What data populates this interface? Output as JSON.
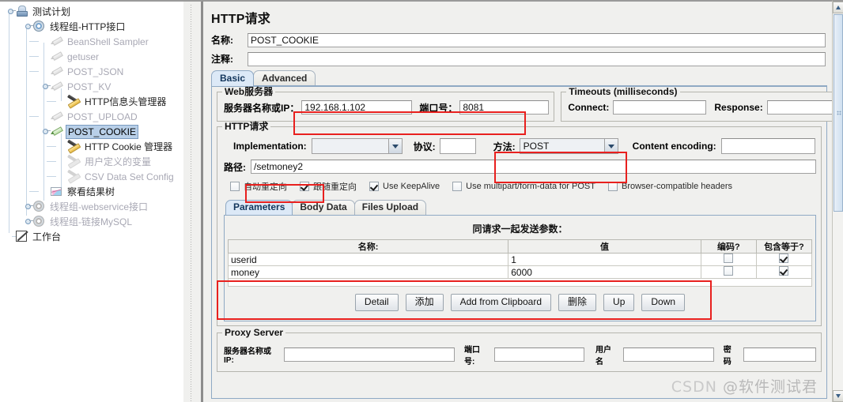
{
  "tree": {
    "nodes": [
      {
        "label": "测试计划",
        "icon": "test-plan-icon",
        "depth": 0,
        "state": "normal"
      },
      {
        "label": "线程组-HTTP接口",
        "icon": "thread-group-icon",
        "depth": 1,
        "state": "normal"
      },
      {
        "label": "BeanShell Sampler",
        "icon": "sampler-icon",
        "depth": 2,
        "state": "disabled"
      },
      {
        "label": "getuser",
        "icon": "sampler-icon",
        "depth": 2,
        "state": "disabled"
      },
      {
        "label": "POST_JSON",
        "icon": "sampler-icon",
        "depth": 2,
        "state": "disabled"
      },
      {
        "label": "POST_KV",
        "icon": "sampler-icon",
        "depth": 2,
        "state": "disabled"
      },
      {
        "label": "HTTP信息头管理器",
        "icon": "header-manager-icon",
        "depth": 3,
        "state": "normal"
      },
      {
        "label": "POST_UPLOAD",
        "icon": "sampler-icon",
        "depth": 2,
        "state": "disabled"
      },
      {
        "label": "POST_COOKIE",
        "icon": "http-sampler-icon",
        "depth": 2,
        "state": "selected"
      },
      {
        "label": "HTTP Cookie 管理器",
        "icon": "cookie-manager-icon",
        "depth": 3,
        "state": "normal"
      },
      {
        "label": "用户定义的变量",
        "icon": "user-variables-icon",
        "depth": 3,
        "state": "disabled"
      },
      {
        "label": "CSV Data Set Config",
        "icon": "csv-config-icon",
        "depth": 3,
        "state": "disabled"
      },
      {
        "label": "察看结果树",
        "icon": "view-results-tree-icon",
        "depth": 2,
        "state": "normal"
      },
      {
        "label": "线程组-webservice接口",
        "icon": "thread-group-icon",
        "depth": 1,
        "state": "disabled"
      },
      {
        "label": "线程组-链接MySQL",
        "icon": "thread-group-icon",
        "depth": 1,
        "state": "disabled"
      },
      {
        "label": "工作台",
        "icon": "workbench-icon",
        "depth": 0,
        "state": "normal"
      }
    ]
  },
  "main": {
    "title": "HTTP请求",
    "name_label": "名称:",
    "name_value": "POST_COOKIE",
    "comment_label": "注释:",
    "comment_value": "",
    "tabs": [
      {
        "label": "Basic",
        "active": true
      },
      {
        "label": "Advanced",
        "active": false
      }
    ],
    "web_server": {
      "legend": "Web服务器",
      "server_label": "服务器名称或IP：",
      "server_value": "192.168.1.102",
      "port_label": "端口号：",
      "port_value": "8081"
    },
    "timeouts": {
      "legend": "Timeouts (milliseconds)",
      "connect_label": "Connect:",
      "connect_value": "",
      "response_label": "Response:",
      "response_value": ""
    },
    "http_request": {
      "legend": "HTTP请求",
      "implementation_label": "Implementation:",
      "implementation_value": "",
      "protocol_label": "协议:",
      "protocol_value": "",
      "method_label": "方法:",
      "method_value": "POST",
      "content_encoding_label": "Content encoding:",
      "content_encoding_value": "",
      "path_label": "路径:",
      "path_value": "/setmoney2"
    },
    "options": [
      {
        "label": "自动重定向",
        "checked": false
      },
      {
        "label": "跟随重定向",
        "checked": true
      },
      {
        "label": "Use KeepAlive",
        "checked": true
      },
      {
        "label": "Use multipart/form-data for POST",
        "checked": false
      },
      {
        "label": "Browser-compatible headers",
        "checked": false
      }
    ],
    "inner_tabs": [
      {
        "label": "Parameters",
        "active": true
      },
      {
        "label": "Body Data",
        "active": false
      },
      {
        "label": "Files Upload",
        "active": false
      }
    ],
    "params": {
      "title": "同请求一起发送参数：",
      "columns": [
        "名称:",
        "值",
        "编码?",
        "包含等于?"
      ],
      "rows": [
        {
          "name": "userid",
          "value": "1",
          "encode": false,
          "include_equals": true
        },
        {
          "name": "money",
          "value": "6000",
          "encode": false,
          "include_equals": true
        }
      ]
    },
    "param_buttons": [
      "Detail",
      "添加",
      "Add from Clipboard",
      "删除",
      "Up",
      "Down"
    ],
    "proxy": {
      "legend": "Proxy Server",
      "server_label": "服务器名称或IP:",
      "server_value": "",
      "port_label": "端口号:",
      "port_value": "",
      "user_label": "用户名",
      "user_value": "",
      "password_label": "密码",
      "password_value": ""
    }
  },
  "watermark": {
    "csdn": "CSDN",
    "author": "@软件测试君"
  },
  "colors": {
    "highlight": "#e8201e",
    "selection": "#b8cfe8",
    "tab_active": "#dce9f7"
  }
}
